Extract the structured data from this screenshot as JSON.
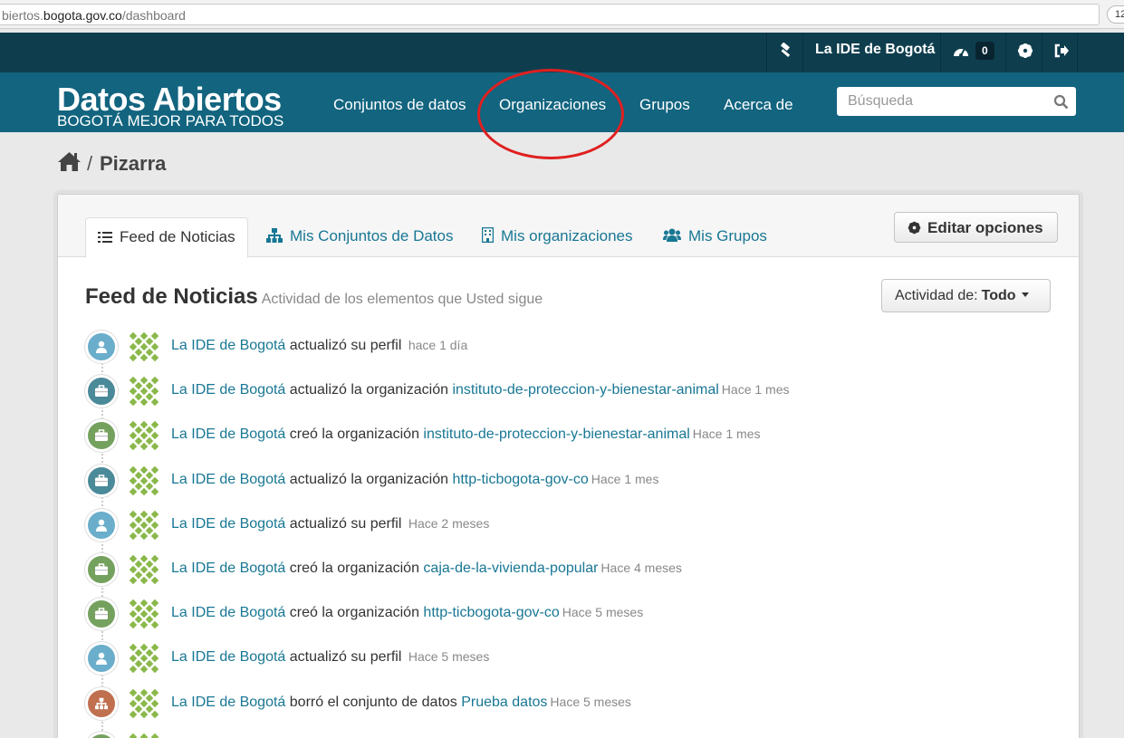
{
  "browser": {
    "url_prefix": "biertos.",
    "url_host": "bogota.gov.co",
    "url_path": "/dashboard",
    "zoom_text": "12"
  },
  "account": {
    "user_name": "La IDE de Bogotá",
    "dashboard_count": "0"
  },
  "header": {
    "title": "Datos Abiertos",
    "subtitle": "BOGOTÁ MEJOR PARA TODOS",
    "nav": [
      "Conjuntos de datos",
      "Organizaciones",
      "Grupos",
      "Acerca de"
    ],
    "search_placeholder": "Búsqueda"
  },
  "breadcrumb": {
    "separator": "/",
    "current": "Pizarra"
  },
  "tabs": [
    "Feed de Noticias",
    "Mis Conjuntos de Datos",
    "Mis organizaciones",
    "Mis Grupos"
  ],
  "edit_button": "Editar opciones",
  "feed": {
    "title": "Feed de Noticias",
    "subtitle": "Actividad de los elementos que Usted sigue",
    "filter_label": "Actividad de:",
    "filter_value": "Todo",
    "items": [
      {
        "type": "user",
        "color": "#6aaecb",
        "actor": "La IDE de Bogotá",
        "verb": "actualizó su perfil",
        "object": "",
        "time": "hace 1 día"
      },
      {
        "type": "org",
        "color": "#4a8a99",
        "actor": "La IDE de Bogotá",
        "verb": "actualizó la organización",
        "object": "instituto-de-proteccion-y-bienestar-animal",
        "time": "Hace 1 mes"
      },
      {
        "type": "org",
        "color": "#75a15e",
        "actor": "La IDE de Bogotá",
        "verb": "creó la organización",
        "object": "instituto-de-proteccion-y-bienestar-animal",
        "time": "Hace 1 mes"
      },
      {
        "type": "org",
        "color": "#4a8a99",
        "actor": "La IDE de Bogotá",
        "verb": "actualizó la organización",
        "object": "http-ticbogota-gov-co",
        "time": "Hace 1 mes"
      },
      {
        "type": "user",
        "color": "#6aaecb",
        "actor": "La IDE de Bogotá",
        "verb": "actualizó su perfil",
        "object": "",
        "time": "Hace 2 meses"
      },
      {
        "type": "org",
        "color": "#75a15e",
        "actor": "La IDE de Bogotá",
        "verb": "creó la organización",
        "object": "caja-de-la-vivienda-popular",
        "time": "Hace 4 meses"
      },
      {
        "type": "org",
        "color": "#75a15e",
        "actor": "La IDE de Bogotá",
        "verb": "creó la organización",
        "object": "http-ticbogota-gov-co",
        "time": "Hace 5 meses"
      },
      {
        "type": "user",
        "color": "#6aaecb",
        "actor": "La IDE de Bogotá",
        "verb": "actualizó su perfil",
        "object": "",
        "time": "Hace 5 meses"
      },
      {
        "type": "dataset",
        "color": "#c0704f",
        "actor": "La IDE de Bogotá",
        "verb": "borró el conjunto de datos",
        "object": "Prueba datos",
        "time": "Hace 5 meses"
      },
      {
        "type": "org",
        "color": "#75a15e",
        "actor": "",
        "verb": "",
        "object": "",
        "time": ""
      }
    ]
  }
}
